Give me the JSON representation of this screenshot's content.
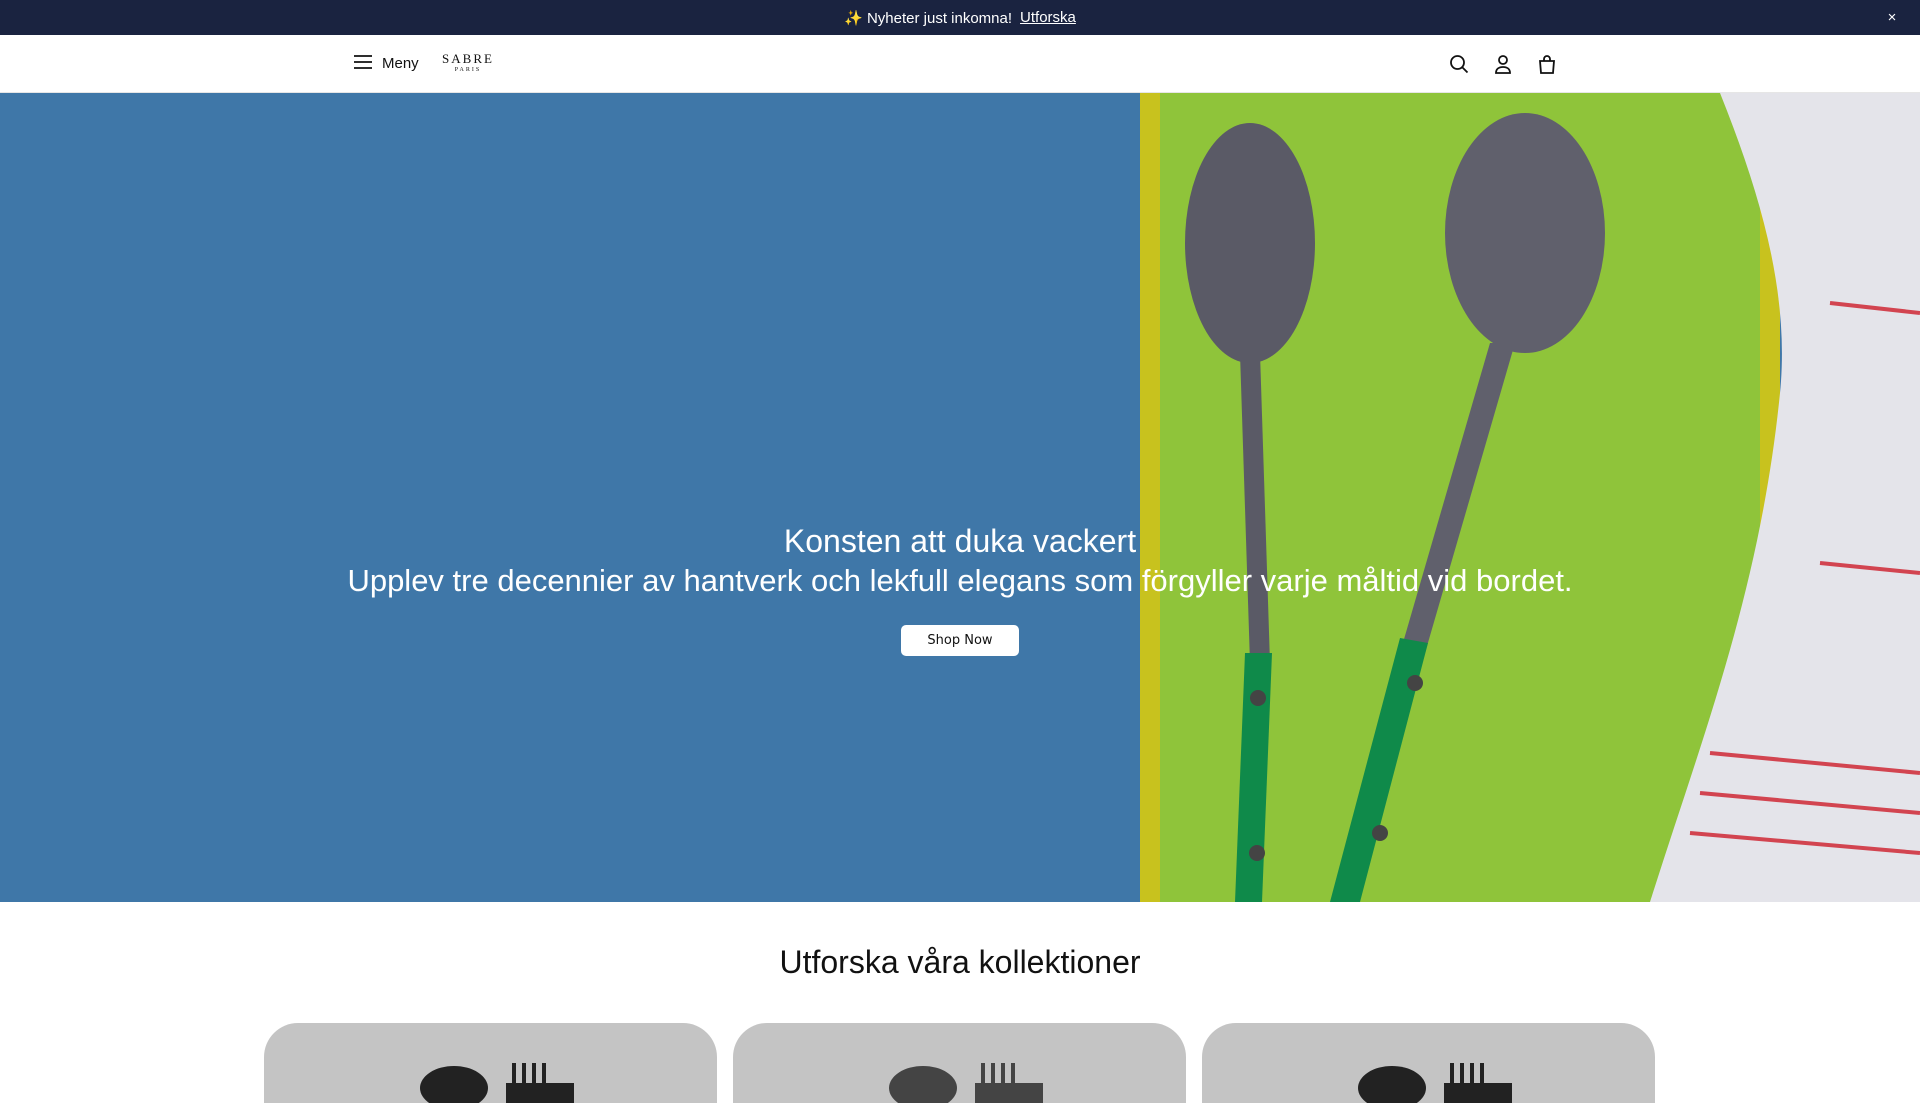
{
  "announcement": {
    "icon": "sparkles-icon",
    "text": "✨ Nyheter just inkomna!",
    "link": "Utforska",
    "close": "×"
  },
  "header": {
    "menu_label": "Meny",
    "logo_main": "SABRE",
    "logo_sub": "PARIS",
    "icons": [
      "search-icon",
      "account-icon",
      "cart-icon"
    ]
  },
  "hero": {
    "title": "Konsten att duka vackert",
    "subtitle": "Upplev tre decennier av hantverk och lekfull elegans som förgyller varje måltid vid bordet.",
    "button": "Shop Now",
    "colors": {
      "blue": "#3f77a8",
      "green": "#8fc43a",
      "yellow": "#c8c21e",
      "handle": "#0f8a4a"
    }
  },
  "collections": {
    "heading": "Utforska våra kollektioner",
    "cards": [
      {
        "image": "cutlery-image"
      },
      {
        "image": "cutlery-image"
      },
      {
        "image": "cutlery-image"
      }
    ]
  }
}
